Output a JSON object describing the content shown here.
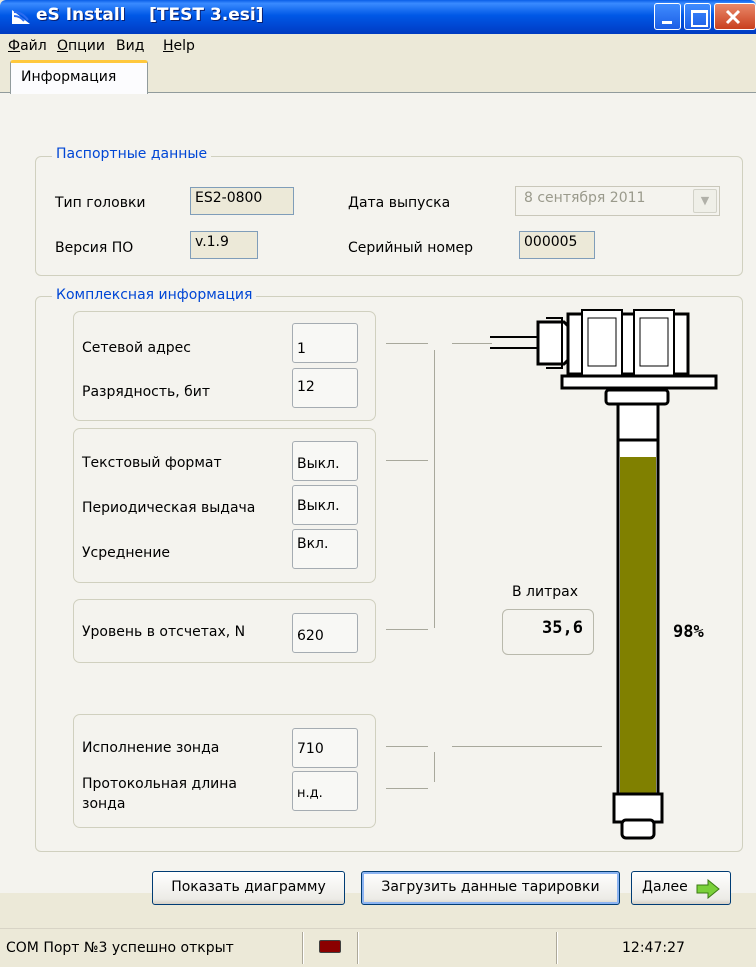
{
  "window": {
    "title": "eS Install    [TEST 3.esi]"
  },
  "menu": {
    "items": [
      {
        "label": "Файл",
        "mnemonic": "Ф"
      },
      {
        "label": "Опции",
        "mnemonic": "О"
      },
      {
        "label": "Вид",
        "mnemonic": ""
      },
      {
        "label": "Help",
        "mnemonic": "H"
      }
    ]
  },
  "tabs": {
    "active": "Информация"
  },
  "passport": {
    "legend": "Паспортные данные",
    "head_type_label": "Тип головки",
    "head_type_value": "ES2-0800",
    "release_date_label": "Дата выпуска",
    "release_date_value": "8 сентября 2011",
    "software_label": "Версия ПО",
    "software_value": "v.1.9",
    "serial_label": "Серийный номер",
    "serial_value": "000005"
  },
  "complex": {
    "legend": "Комплексная информация",
    "network_address_label": "Сетевой адрес",
    "network_address_value": "1",
    "bit_depth_label": "Разрядность, бит",
    "bit_depth_value": "12",
    "text_format_label": "Текстовый формат",
    "text_format_value": "Выкл.",
    "periodic_label": "Периодическая выдача",
    "periodic_value": "Выкл.",
    "averaging_label": "Усреднение",
    "averaging_value": "Вкл.",
    "level_label": "Уровень в отсчетах,  N",
    "level_value": "620",
    "probe_version_label": "Исполнение зонда",
    "probe_version_value": "710",
    "protocol_length_label_1": "Протокольная длина",
    "protocol_length_label_2": "зонда",
    "protocol_length_value": "н.д.",
    "litres_label": "В литрах",
    "litres_value": "35,6",
    "percent_value": "98%",
    "fill_fraction": 0.98,
    "fill_color": "#808000"
  },
  "buttons": {
    "show_diagram": "Показать диаграмму",
    "load_calibration": "Загрузить данные тарировки",
    "next": "Далее"
  },
  "status": {
    "port_message": "COM Порт №3 успешно открыт",
    "indicator_color": "#8b0000",
    "time": "12:47:27"
  }
}
